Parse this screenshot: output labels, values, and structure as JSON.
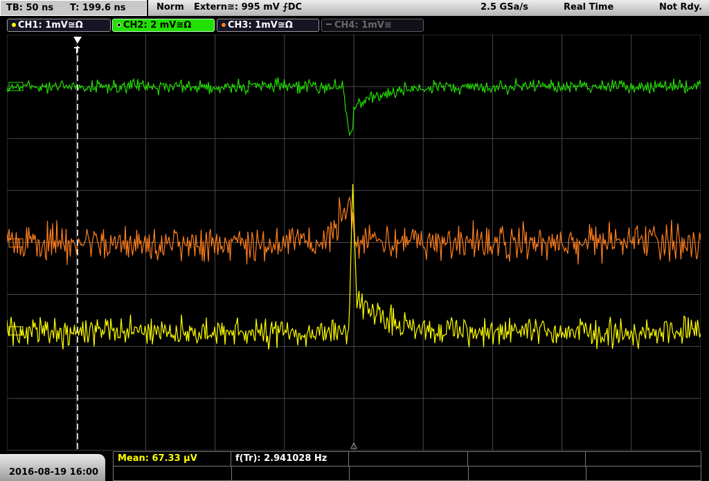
{
  "header": {
    "timebase": "TB: 50 ns",
    "trigger_time": "T: 199.6 ns",
    "acq_mode": "Norm",
    "trigger_source": "Extern≅: 995 mV ⨍DC",
    "sample_rate": "2.5 GSa/s",
    "time_mode": "Real Time",
    "state": "Not Rdy."
  },
  "channels": [
    {
      "label": "CH1: 1mV≅Ω",
      "color": "#ffff00",
      "active": false
    },
    {
      "label": "CH2: 2 mV≅Ω",
      "color": "#22e000",
      "active": true
    },
    {
      "label": "CH3: 1mV≅Ω",
      "color": "#ff7f1e",
      "active": false
    },
    {
      "label": "CH4: 1mV≅",
      "color": "#6a6a6a",
      "active": false
    }
  ],
  "footer": {
    "datetime": "2016-08-19 16:00",
    "measurements": [
      {
        "label": "Mean: 67.33 µV",
        "color": "#ffff00"
      },
      {
        "label": "f(Tr): 2.941028 Hz",
        "color": "#ffffff"
      }
    ]
  },
  "colors": {
    "grid": "#4a4a4a",
    "ch1": "#ffff00",
    "ch2": "#22e000",
    "ch3": "#ff7f1e",
    "trigger_marker": "#ffffff"
  },
  "markers": {
    "trigger_label": "T"
  }
}
